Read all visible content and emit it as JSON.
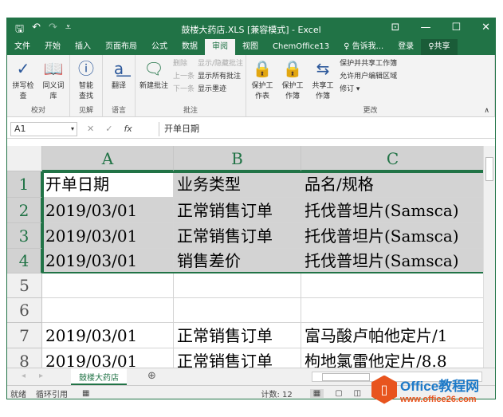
{
  "title": "鼓楼大药店.XLS  [兼容模式] - Excel",
  "quick_access": {
    "save": "🖫",
    "undo": "↶",
    "redo": "↷",
    "customize": "⩡"
  },
  "window_controls": {
    "ribbon_display": "⊡",
    "minimize": "—",
    "maximize": "☐",
    "close": "✕"
  },
  "tabs": [
    "文件",
    "开始",
    "插入",
    "页面布局",
    "公式",
    "数据",
    "审阅",
    "视图",
    "ChemOffice13",
    "♀ 告诉我...",
    "登录",
    "♀共享"
  ],
  "active_tab": "审阅",
  "ribbon": {
    "proofing": {
      "label": "校对",
      "spell": "拼写检查",
      "thesaurus": "同义词库"
    },
    "insights": {
      "label": "见解",
      "smart": "智能查找"
    },
    "language": {
      "label": "语言",
      "translate": "翻译"
    },
    "comments": {
      "label": "批注",
      "new": "新建批注",
      "delete": "删除",
      "prev": "上一条",
      "next": "下一条",
      "show_hide": "显示/隐藏批注",
      "show_all": "显示所有批注",
      "show_ink": "显示墨迹"
    },
    "changes": {
      "label": "更改",
      "protect_sheet": "保护工作表",
      "protect_wb": "保护工作簿",
      "share_wb": "共享工作簿",
      "protect_share": "保护并共享工作簿",
      "allow_edit": "允许用户编辑区域",
      "track": "修订 ▾"
    }
  },
  "formula_bar": {
    "name_box": "A1",
    "fx": "fx",
    "value": "开单日期"
  },
  "columns": [
    "A",
    "B",
    "C"
  ],
  "rows": [
    {
      "num": "1",
      "cells": [
        "开单日期",
        "业务类型",
        "品名/规格"
      ]
    },
    {
      "num": "2",
      "cells": [
        "2019/03/01",
        "正常销售订单",
        "托伐普坦片(Samsca)"
      ]
    },
    {
      "num": "3",
      "cells": [
        "2019/03/01",
        "正常销售订单",
        "托伐普坦片(Samsca)"
      ]
    },
    {
      "num": "4",
      "cells": [
        "2019/03/01",
        "销售差价",
        "托伐普坦片(Samsca)"
      ]
    },
    {
      "num": "5",
      "cells": [
        "",
        "",
        ""
      ]
    },
    {
      "num": "6",
      "cells": [
        "",
        "",
        ""
      ]
    },
    {
      "num": "7",
      "cells": [
        "2019/03/01",
        "正常销售订单",
        "富马酸卢帕他定片/1"
      ]
    },
    {
      "num": "8",
      "cells": [
        "2019/03/01",
        "正常销售订单",
        "枸地氯雷他定片/8.8"
      ]
    }
  ],
  "sheet_tab": "鼓楼大药店",
  "status": {
    "ready": "就绪",
    "circular": "循环引用",
    "count": "计数: 12"
  },
  "watermark": {
    "brand": "Office教程网",
    "url": "www.office26.com"
  },
  "colors": {
    "accent": "#217346"
  }
}
